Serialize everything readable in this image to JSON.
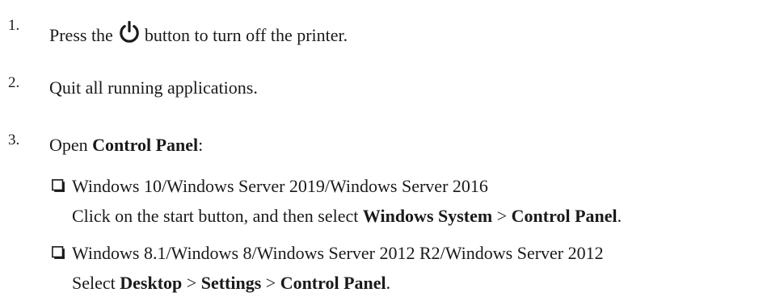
{
  "steps": [
    {
      "number": "1.",
      "text_before": "Press the",
      "icon": "power-icon",
      "text_after": "button to turn off the printer."
    },
    {
      "number": "2.",
      "text": "Quit all running applications."
    },
    {
      "number": "3.",
      "text_before": "Open ",
      "bold": "Control Panel",
      "text_after": ":"
    }
  ],
  "sub_items": [
    {
      "heading": "Windows 10/Windows Server 2019/Windows Server 2016",
      "instruction": {
        "pre": "Click on the start button, and then select ",
        "bold1": "Windows System",
        "sep": " > ",
        "bold2": "Control Panel",
        "end": "."
      }
    },
    {
      "heading": "Windows 8.1/Windows 8/Windows Server 2012 R2/Windows Server 2012",
      "instruction": {
        "pre": "Select ",
        "bold1": "Desktop",
        "sep1": " > ",
        "bold2": "Settings",
        "sep2": " > ",
        "bold3": "Control Panel",
        "end": "."
      }
    }
  ]
}
